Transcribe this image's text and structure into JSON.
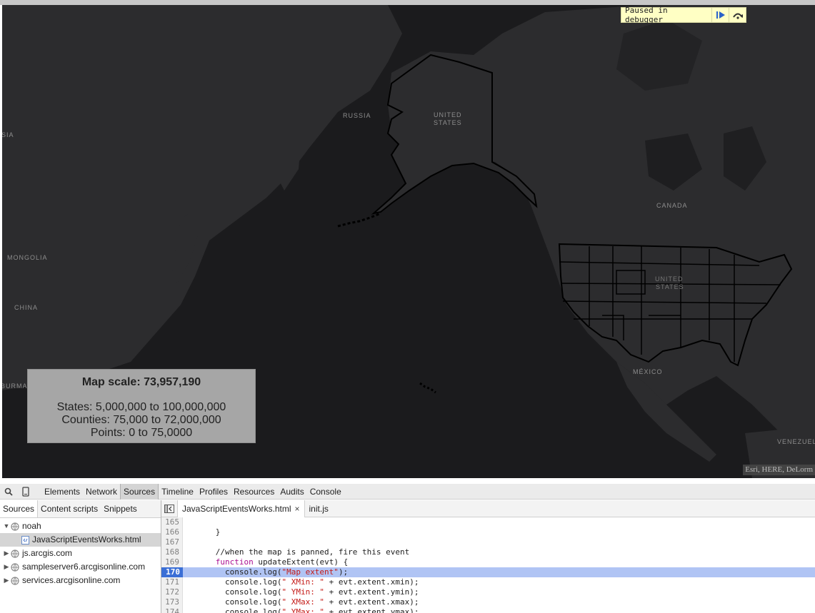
{
  "map": {
    "labels": {
      "russia": "RUSSIA",
      "united_states_ak_1": "UNITED",
      "united_states_ak_2": "STATES",
      "canada": "CANADA",
      "united_states_1": "UNITED",
      "united_states_2": "STATES",
      "mongolia": "MONGOLIA",
      "china": "CHINA",
      "mexico": "MÉXICO",
      "sia": "SIA",
      "burma": "BURMA",
      "venezuela": "VENEZUELA"
    },
    "attribution": "Esri, HERE, DeLorm"
  },
  "debugger": {
    "paused_label": "Paused in debugger"
  },
  "scale_info": {
    "title": "Map scale: 73,957,190",
    "states": "States: 5,000,000 to 100,000,000",
    "counties": "Counties: 75,000 to 72,000,000",
    "points": "Points: 0 to 75,0000"
  },
  "devtools": {
    "tabs": [
      "Elements",
      "Network",
      "Sources",
      "Timeline",
      "Profiles",
      "Resources",
      "Audits",
      "Console"
    ],
    "active_tab": "Sources",
    "navigator_tabs": [
      "Sources",
      "Content scripts",
      "Snippets"
    ],
    "tree": {
      "root": "noah",
      "selected_file": "JavaScriptEventsWorks.html",
      "domains": [
        "js.arcgis.com",
        "sampleserver6.arcgisonline.com",
        "services.arcgisonline.com"
      ]
    },
    "editor_tabs": [
      "JavaScriptEventsWorks.html",
      "init.js"
    ],
    "close_glyph": "×",
    "code_lines": [
      {
        "n": "165",
        "text": ""
      },
      {
        "n": "166",
        "text": "      }"
      },
      {
        "n": "167",
        "text": ""
      },
      {
        "n": "168",
        "text": "      //when the map is panned, fire this event"
      },
      {
        "n": "169",
        "kw": "function",
        "rest": " updateExtent(evt) {"
      },
      {
        "n": "170",
        "pre": "        console.log(",
        "str": "\"Map extent\"",
        "post": ");"
      },
      {
        "n": "171",
        "pre": "        console.log(",
        "str": "\" XMin: \"",
        "post": " + evt.extent.xmin);"
      },
      {
        "n": "172",
        "pre": "        console.log(",
        "str": "\" YMin: \"",
        "post": " + evt.extent.ymin);"
      },
      {
        "n": "173",
        "pre": "        console.log(",
        "str": "\" XMax: \"",
        "post": " + evt.extent.xmax);"
      },
      {
        "n": "174",
        "pre": "        console.log(",
        "str": "\" YMax: \"",
        "post": " + evt.extent.ymax);"
      }
    ],
    "current_line": "170"
  }
}
